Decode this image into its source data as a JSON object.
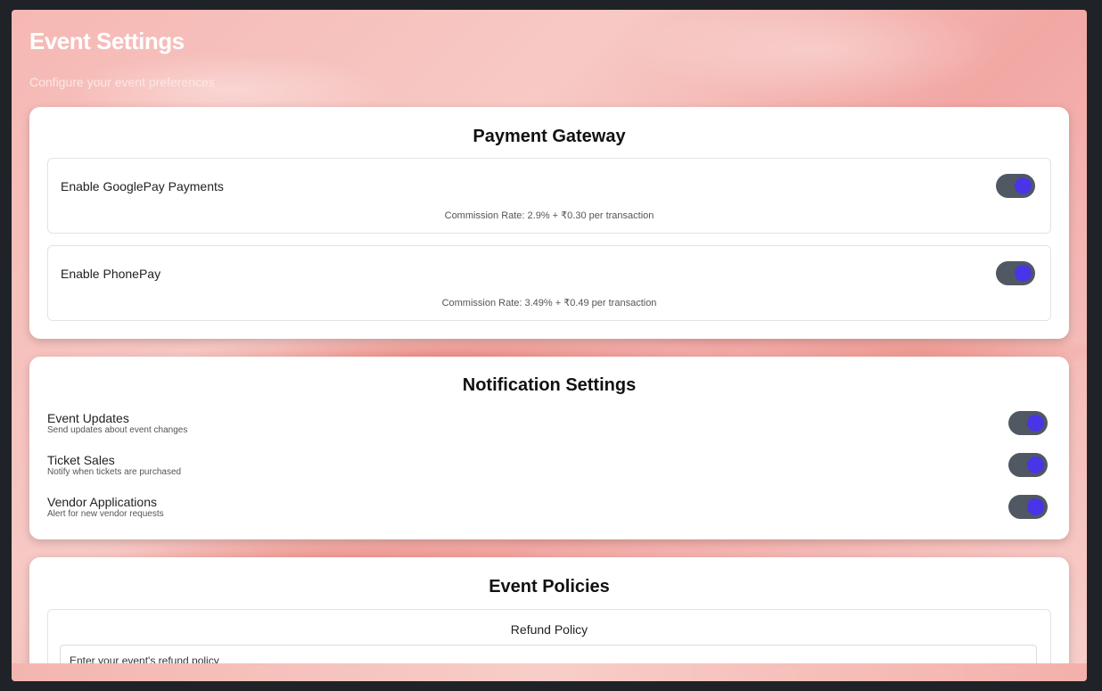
{
  "page": {
    "title": "Event Settings",
    "subtitle": "Configure your event preferences"
  },
  "payment_gateway": {
    "heading": "Payment Gateway",
    "items": [
      {
        "label": "Enable GooglePay Payments",
        "rate": "Commission Rate: 2.9% + ₹0.30 per transaction",
        "enabled": true
      },
      {
        "label": "Enable PhonePay",
        "rate": "Commission Rate: 3.49% + ₹0.49 per transaction",
        "enabled": true
      }
    ]
  },
  "notifications": {
    "heading": "Notification Settings",
    "items": [
      {
        "title": "Event Updates",
        "desc": "Send updates about event changes",
        "enabled": true
      },
      {
        "title": "Ticket Sales",
        "desc": "Notify when tickets are purchased",
        "enabled": true
      },
      {
        "title": "Vendor Applications",
        "desc": "Alert for new vendor requests",
        "enabled": true
      }
    ]
  },
  "policies": {
    "heading": "Event Policies",
    "refund_label": "Refund Policy",
    "refund_placeholder": "Enter your event's refund policy"
  },
  "colors": {
    "toggle_track": "#505863",
    "toggle_knob": "#4a34e8"
  }
}
